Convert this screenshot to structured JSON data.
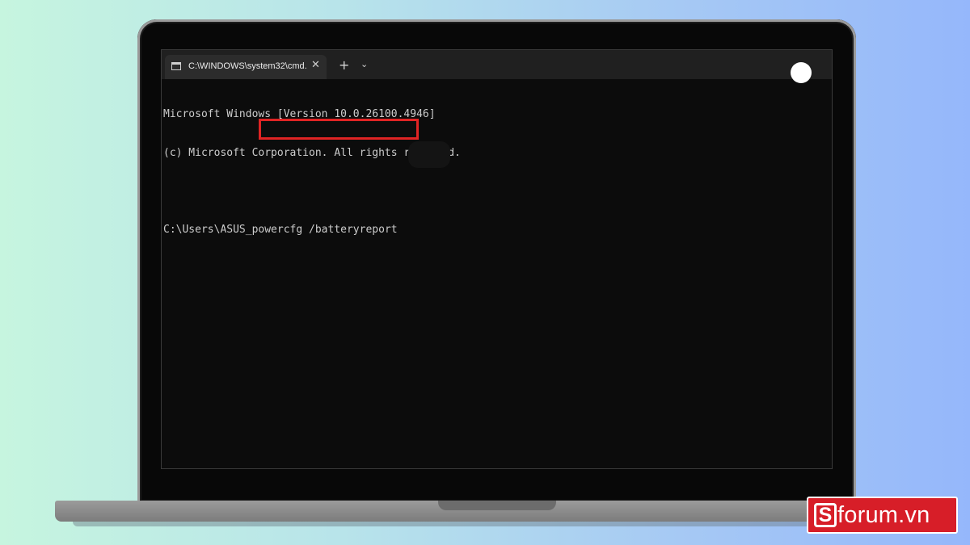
{
  "terminal": {
    "tab_title": "C:\\WINDOWS\\system32\\cmd.",
    "tab_close": "✕",
    "new_tab": "+",
    "dropdown": "⌄",
    "tab_icon": "terminal-icon",
    "lines": [
      "Microsoft Windows [Version 10.0.26100.4946]",
      "(c) Microsoft Corporation. All rights reserved."
    ],
    "prompt": "C:\\Users\\ASUS_",
    "command": "powercfg /batteryreport",
    "highlight_color": "#e02424"
  },
  "watermark": {
    "logo_letter": "S",
    "text": "forum.vn",
    "color": "#d71e28"
  }
}
